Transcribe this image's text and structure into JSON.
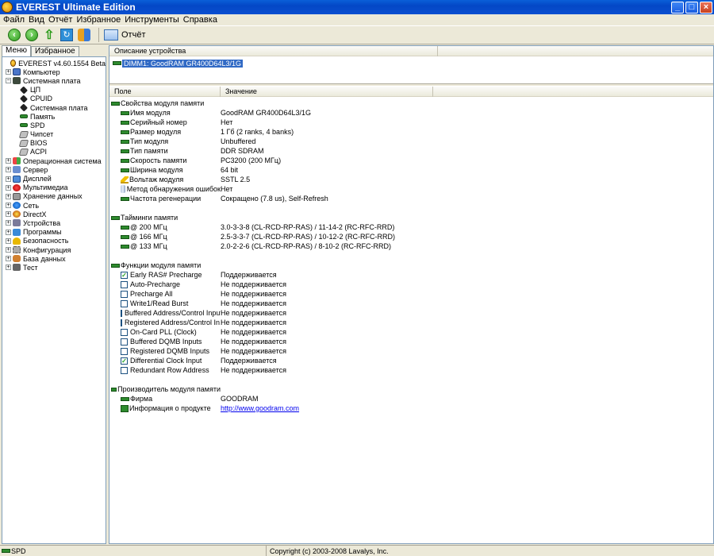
{
  "window": {
    "title": "EVEREST Ultimate Edition"
  },
  "menu": [
    "Файл",
    "Вид",
    "Отчёт",
    "Избранное",
    "Инструменты",
    "Справка"
  ],
  "toolbar": {
    "report_label": "Отчёт"
  },
  "left_tabs": [
    "Меню",
    "Избранное"
  ],
  "tree": [
    {
      "label": "EVEREST v4.60.1554 Beta",
      "level": 0,
      "expander": "",
      "icon": "ico-root"
    },
    {
      "label": "Компьютер",
      "level": 0,
      "expander": "+",
      "icon": "ico-pc"
    },
    {
      "label": "Системная плата",
      "level": 0,
      "expander": "-",
      "icon": "ico-board"
    },
    {
      "label": "ЦП",
      "level": 1,
      "expander": "",
      "icon": "ico-chip"
    },
    {
      "label": "CPUID",
      "level": 1,
      "expander": "",
      "icon": "ico-chip"
    },
    {
      "label": "Системная плата",
      "level": 1,
      "expander": "",
      "icon": "ico-chip"
    },
    {
      "label": "Память",
      "level": 1,
      "expander": "",
      "icon": "ico-ram"
    },
    {
      "label": "SPD",
      "level": 1,
      "expander": "",
      "icon": "ico-ram"
    },
    {
      "label": "Чипсет",
      "level": 1,
      "expander": "",
      "icon": "ico-disk"
    },
    {
      "label": "BIOS",
      "level": 1,
      "expander": "",
      "icon": "ico-disk"
    },
    {
      "label": "ACPI",
      "level": 1,
      "expander": "",
      "icon": "ico-disk"
    },
    {
      "label": "Операционная система",
      "level": 0,
      "expander": "+",
      "icon": "ico-win"
    },
    {
      "label": "Сервер",
      "level": 0,
      "expander": "+",
      "icon": "ico-srv"
    },
    {
      "label": "Дисплей",
      "level": 0,
      "expander": "+",
      "icon": "ico-monitor"
    },
    {
      "label": "Мультимедиа",
      "level": 0,
      "expander": "+",
      "icon": "ico-media"
    },
    {
      "label": "Хранение данных",
      "level": 0,
      "expander": "+",
      "icon": "ico-hdd"
    },
    {
      "label": "Сеть",
      "level": 0,
      "expander": "+",
      "icon": "ico-net"
    },
    {
      "label": "DirectX",
      "level": 0,
      "expander": "+",
      "icon": "ico-dx"
    },
    {
      "label": "Устройства",
      "level": 0,
      "expander": "+",
      "icon": "ico-dev"
    },
    {
      "label": "Программы",
      "level": 0,
      "expander": "+",
      "icon": "ico-prog"
    },
    {
      "label": "Безопасность",
      "level": 0,
      "expander": "+",
      "icon": "ico-sec"
    },
    {
      "label": "Конфигурация",
      "level": 0,
      "expander": "+",
      "icon": "ico-cfg"
    },
    {
      "label": "База данных",
      "level": 0,
      "expander": "+",
      "icon": "ico-db"
    },
    {
      "label": "Тест",
      "level": 0,
      "expander": "+",
      "icon": "ico-test"
    }
  ],
  "device_header": "Описание устройства",
  "device": "DIMM1: GoodRAM GR400D64L3/1G",
  "columns": {
    "field": "Поле",
    "value": "Значение"
  },
  "rows": [
    {
      "type": "section",
      "field": "Свойства модуля памяти",
      "icon": "ram"
    },
    {
      "type": "item",
      "field": "Имя модуля",
      "value": "GoodRAM GR400D64L3/1G",
      "icon": "ram"
    },
    {
      "type": "item",
      "field": "Серийный номер",
      "value": "Нет",
      "icon": "ram"
    },
    {
      "type": "item",
      "field": "Размер модуля",
      "value": "1 Гб (2 ranks, 4 banks)",
      "icon": "ram"
    },
    {
      "type": "item",
      "field": "Тип модуля",
      "value": "Unbuffered",
      "icon": "ram"
    },
    {
      "type": "item",
      "field": "Тип памяти",
      "value": "DDR SDRAM",
      "icon": "ram"
    },
    {
      "type": "item",
      "field": "Скорость памяти",
      "value": "PC3200 (200 МГц)",
      "icon": "ram"
    },
    {
      "type": "item",
      "field": "Ширина модуля",
      "value": "64 bit",
      "icon": "ram"
    },
    {
      "type": "item",
      "field": "Вольтаж модуля",
      "value": "SSTL 2.5",
      "icon": "warn"
    },
    {
      "type": "item",
      "field": "Метод обнаружения ошибок",
      "value": "Нет",
      "icon": "cyl"
    },
    {
      "type": "item",
      "field": "Частота регенерации",
      "value": "Сокращено (7.8 us), Self-Refresh",
      "icon": "ram"
    },
    {
      "type": "blank"
    },
    {
      "type": "section",
      "field": "Тайминги памяти",
      "icon": "ram"
    },
    {
      "type": "item",
      "field": "@ 200 МГц",
      "value": "3.0-3-3-8  (CL-RCD-RP-RAS) / 11-14-2  (RC-RFC-RRD)",
      "icon": "ram"
    },
    {
      "type": "item",
      "field": "@ 166 МГц",
      "value": "2.5-3-3-7  (CL-RCD-RP-RAS) / 10-12-2  (RC-RFC-RRD)",
      "icon": "ram"
    },
    {
      "type": "item",
      "field": "@ 133 МГц",
      "value": "2.0-2-2-6  (CL-RCD-RP-RAS) / 8-10-2  (RC-RFC-RRD)",
      "icon": "ram"
    },
    {
      "type": "blank"
    },
    {
      "type": "section",
      "field": "Функции модуля памяти",
      "icon": "ram"
    },
    {
      "type": "check",
      "field": "Early RAS# Precharge",
      "value": "Поддерживается",
      "checked": true
    },
    {
      "type": "check",
      "field": "Auto-Precharge",
      "value": "Не поддерживается",
      "checked": false
    },
    {
      "type": "check",
      "field": "Precharge All",
      "value": "Не поддерживается",
      "checked": false
    },
    {
      "type": "check",
      "field": "Write1/Read Burst",
      "value": "Не поддерживается",
      "checked": false
    },
    {
      "type": "check",
      "field": "Buffered Address/Control Inputs",
      "value": "Не поддерживается",
      "checked": false
    },
    {
      "type": "check",
      "field": "Registered Address/Control In...",
      "value": "Не поддерживается",
      "checked": false
    },
    {
      "type": "check",
      "field": "On-Card PLL (Clock)",
      "value": "Не поддерживается",
      "checked": false
    },
    {
      "type": "check",
      "field": "Buffered DQMB Inputs",
      "value": "Не поддерживается",
      "checked": false
    },
    {
      "type": "check",
      "field": "Registered DQMB Inputs",
      "value": "Не поддерживается",
      "checked": false
    },
    {
      "type": "check",
      "field": "Differential Clock Input",
      "value": "Поддерживается",
      "checked": true
    },
    {
      "type": "check",
      "field": "Redundant Row Address",
      "value": "Не поддерживается",
      "checked": false
    },
    {
      "type": "blank"
    },
    {
      "type": "section",
      "field": "Производитель модуля памяти",
      "icon": "ram"
    },
    {
      "type": "item",
      "field": "Фирма",
      "value": "GOODRAM",
      "icon": "ram"
    },
    {
      "type": "item",
      "field": "Информация о продукте",
      "value": "http://www.goodram.com",
      "icon": "info",
      "link": true
    }
  ],
  "status": {
    "left": "SPD",
    "right": "Copyright (c) 2003-2008 Lavalys, Inc."
  }
}
